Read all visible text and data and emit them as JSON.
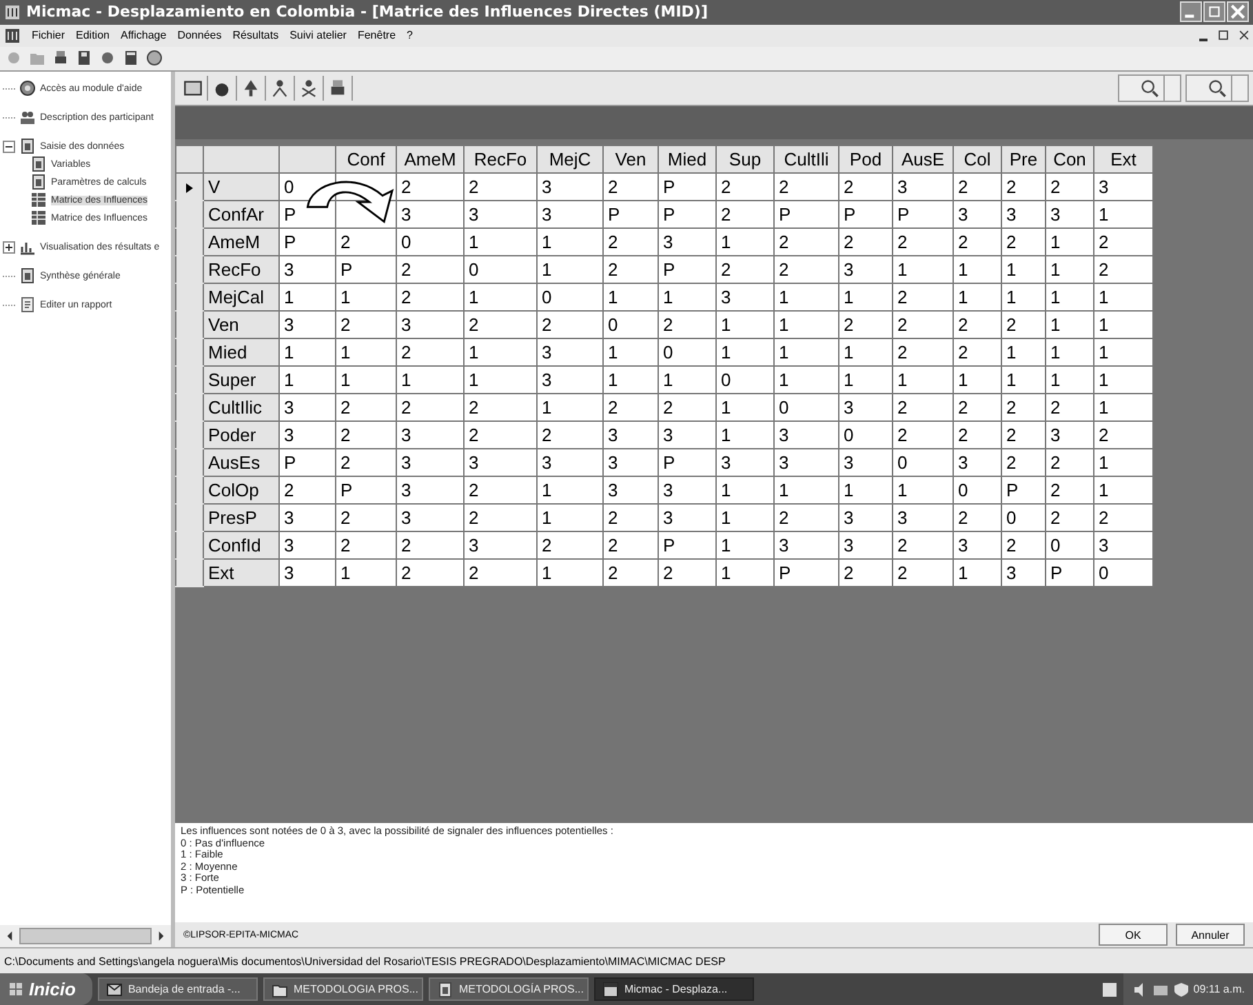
{
  "window": {
    "title": "Micmac  -  Desplazamiento en Colombia - [Matrice des Influences Directes (MID)]"
  },
  "menu": [
    "Fichier",
    "Edition",
    "Affichage",
    "Données",
    "Résultats",
    "Suivi atelier",
    "Fenêtre",
    "?"
  ],
  "sidebar": {
    "items": [
      {
        "label": "Accès au module d'aide",
        "kind": "help"
      },
      {
        "label": "Description des participant",
        "kind": "people"
      },
      {
        "label": "Saisie des données",
        "kind": "doc",
        "expanded": true,
        "children": [
          {
            "label": "Variables",
            "kind": "doc",
            "selected": false
          },
          {
            "label": "Paramètres de calculs",
            "kind": "doc",
            "selected": false
          },
          {
            "label": "Matrice des Influences",
            "kind": "grid",
            "selected": true
          },
          {
            "label": "Matrice des Influences",
            "kind": "grid",
            "selected": false
          }
        ]
      },
      {
        "label": "Visualisation des résultats e",
        "kind": "chart",
        "expanded": false
      },
      {
        "label": "Synthèse générale",
        "kind": "doc"
      },
      {
        "label": "Editer un rapport",
        "kind": "report"
      }
    ]
  },
  "table": {
    "columns": [
      null,
      "Conf",
      "AmeM",
      "RecFo",
      "MejC",
      "Ven",
      "Mied",
      "Sup",
      "CultIli",
      "Pod",
      "AusE",
      "Col",
      "Pre",
      "Con",
      "Ext"
    ],
    "rows": [
      {
        "label": "V",
        "current": true,
        "cells": [
          "0",
          null,
          "2",
          "2",
          "3",
          "2",
          "P",
          "2",
          "2",
          "2",
          "3",
          "2",
          "2",
          "2",
          "3"
        ]
      },
      {
        "label": "ConfAr",
        "current": false,
        "cells": [
          "P",
          null,
          "3",
          "3",
          "3",
          "P",
          "P",
          "2",
          "P",
          "P",
          "P",
          "3",
          "3",
          "3",
          "1"
        ]
      },
      {
        "label": "AmeM",
        "current": false,
        "cells": [
          "P",
          "2",
          "0",
          "1",
          "1",
          "2",
          "3",
          "1",
          "2",
          "2",
          "2",
          "2",
          "2",
          "1",
          "2"
        ]
      },
      {
        "label": "RecFo",
        "current": false,
        "cells": [
          "3",
          "P",
          "2",
          "0",
          "1",
          "2",
          "P",
          "2",
          "2",
          "3",
          "1",
          "1",
          "1",
          "1",
          "2"
        ]
      },
      {
        "label": "MejCal",
        "current": false,
        "cells": [
          "1",
          "1",
          "2",
          "1",
          "0",
          "1",
          "1",
          "3",
          "1",
          "1",
          "2",
          "1",
          "1",
          "1",
          "1"
        ]
      },
      {
        "label": "Ven",
        "current": false,
        "cells": [
          "3",
          "2",
          "3",
          "2",
          "2",
          "0",
          "2",
          "1",
          "1",
          "2",
          "2",
          "2",
          "2",
          "1",
          "1"
        ]
      },
      {
        "label": "Mied",
        "current": false,
        "cells": [
          "1",
          "1",
          "2",
          "1",
          "3",
          "1",
          "0",
          "1",
          "1",
          "1",
          "2",
          "2",
          "1",
          "1",
          "1"
        ]
      },
      {
        "label": "Super",
        "current": false,
        "cells": [
          "1",
          "1",
          "1",
          "1",
          "3",
          "1",
          "1",
          "0",
          "1",
          "1",
          "1",
          "1",
          "1",
          "1",
          "1"
        ]
      },
      {
        "label": "CultIlic",
        "current": false,
        "cells": [
          "3",
          "2",
          "2",
          "2",
          "1",
          "2",
          "2",
          "1",
          "0",
          "3",
          "2",
          "2",
          "2",
          "2",
          "1"
        ]
      },
      {
        "label": "Poder",
        "current": false,
        "cells": [
          "3",
          "2",
          "3",
          "2",
          "2",
          "3",
          "3",
          "1",
          "3",
          "0",
          "2",
          "2",
          "2",
          "3",
          "2"
        ]
      },
      {
        "label": "AusEs",
        "current": false,
        "cells": [
          "P",
          "2",
          "3",
          "3",
          "3",
          "3",
          "P",
          "3",
          "3",
          "3",
          "0",
          "3",
          "2",
          "2",
          "1"
        ]
      },
      {
        "label": "ColOp",
        "current": false,
        "cells": [
          "2",
          "P",
          "3",
          "2",
          "1",
          "3",
          "3",
          "1",
          "1",
          "1",
          "1",
          "0",
          "P",
          "2",
          "1"
        ]
      },
      {
        "label": "PresP",
        "current": false,
        "cells": [
          "3",
          "2",
          "3",
          "2",
          "1",
          "2",
          "3",
          "1",
          "2",
          "3",
          "3",
          "2",
          "0",
          "2",
          "2"
        ]
      },
      {
        "label": "ConfId",
        "current": false,
        "cells": [
          "3",
          "2",
          "2",
          "3",
          "2",
          "2",
          "P",
          "1",
          "3",
          "3",
          "2",
          "3",
          "2",
          "0",
          "3"
        ]
      },
      {
        "label": "Ext",
        "current": false,
        "cells": [
          "3",
          "1",
          "2",
          "2",
          "1",
          "2",
          "2",
          "1",
          "P",
          "2",
          "2",
          "1",
          "3",
          "P",
          "0"
        ]
      }
    ]
  },
  "legend": [
    "Les influences sont notées de 0 à 3, avec la possibilité de signaler des influences potentielles :",
    "0 : Pas d'influence",
    "1 : Faible",
    "2 : Moyenne",
    "3 : Forte",
    "P : Potentielle"
  ],
  "copyright": "©LIPSOR-EPITA-MICMAC",
  "buttons": [
    "OK",
    "Annuler"
  ],
  "status_bar": "C:\\Documents and Settings\\angela noguera\\Mis documentos\\Universidad del Rosario\\TESIS PREGRADO\\Desplazamiento\\MIMAC\\MICMAC DESP",
  "taskbar": {
    "start": "Inicio",
    "tasks": [
      {
        "label": "Bandeja de entrada -...",
        "kind": "mail",
        "selected": false
      },
      {
        "label": "METODOLOGIA PROS...",
        "kind": "folder",
        "selected": false
      },
      {
        "label": "METODOLOGÍA PROS...",
        "kind": "doc",
        "selected": false
      },
      {
        "label": "Micmac  -  Desplaza...",
        "kind": "app",
        "selected": true
      }
    ],
    "clock": "09:11 a.m."
  }
}
